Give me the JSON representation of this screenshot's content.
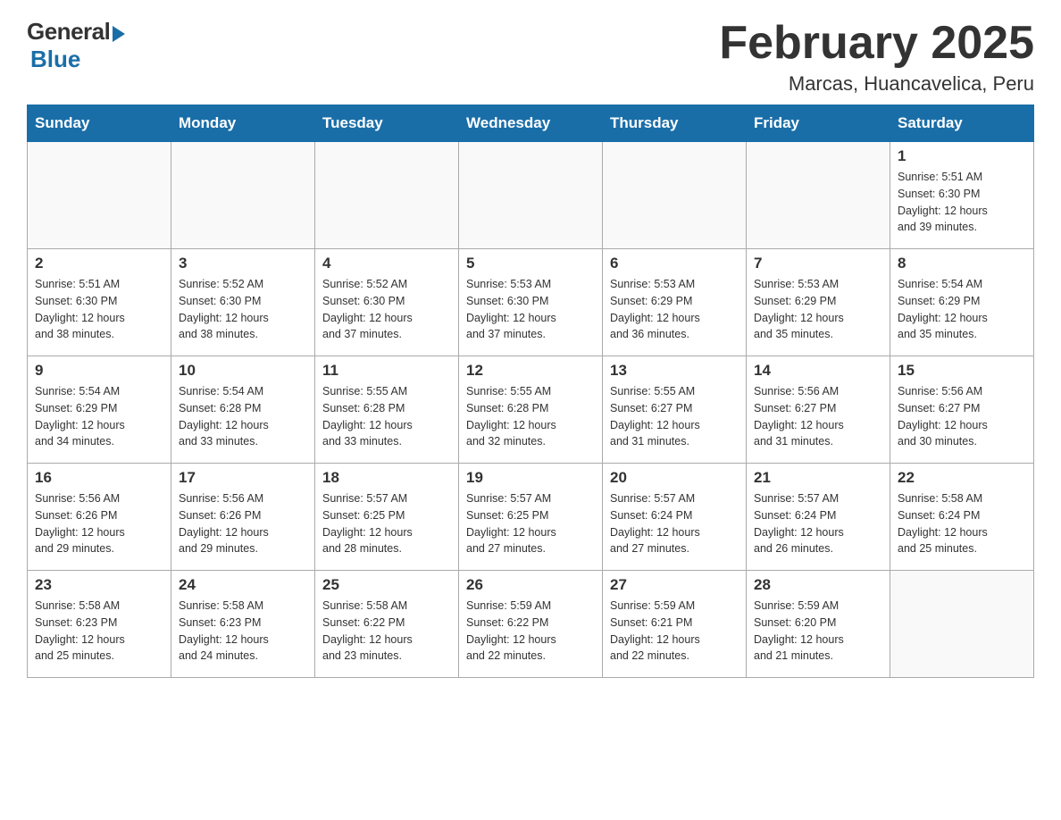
{
  "logo": {
    "general": "General",
    "blue": "Blue"
  },
  "header": {
    "month_year": "February 2025",
    "location": "Marcas, Huancavelica, Peru"
  },
  "weekdays": [
    "Sunday",
    "Monday",
    "Tuesday",
    "Wednesday",
    "Thursday",
    "Friday",
    "Saturday"
  ],
  "weeks": [
    [
      {
        "day": "",
        "info": ""
      },
      {
        "day": "",
        "info": ""
      },
      {
        "day": "",
        "info": ""
      },
      {
        "day": "",
        "info": ""
      },
      {
        "day": "",
        "info": ""
      },
      {
        "day": "",
        "info": ""
      },
      {
        "day": "1",
        "info": "Sunrise: 5:51 AM\nSunset: 6:30 PM\nDaylight: 12 hours\nand 39 minutes."
      }
    ],
    [
      {
        "day": "2",
        "info": "Sunrise: 5:51 AM\nSunset: 6:30 PM\nDaylight: 12 hours\nand 38 minutes."
      },
      {
        "day": "3",
        "info": "Sunrise: 5:52 AM\nSunset: 6:30 PM\nDaylight: 12 hours\nand 38 minutes."
      },
      {
        "day": "4",
        "info": "Sunrise: 5:52 AM\nSunset: 6:30 PM\nDaylight: 12 hours\nand 37 minutes."
      },
      {
        "day": "5",
        "info": "Sunrise: 5:53 AM\nSunset: 6:30 PM\nDaylight: 12 hours\nand 37 minutes."
      },
      {
        "day": "6",
        "info": "Sunrise: 5:53 AM\nSunset: 6:29 PM\nDaylight: 12 hours\nand 36 minutes."
      },
      {
        "day": "7",
        "info": "Sunrise: 5:53 AM\nSunset: 6:29 PM\nDaylight: 12 hours\nand 35 minutes."
      },
      {
        "day": "8",
        "info": "Sunrise: 5:54 AM\nSunset: 6:29 PM\nDaylight: 12 hours\nand 35 minutes."
      }
    ],
    [
      {
        "day": "9",
        "info": "Sunrise: 5:54 AM\nSunset: 6:29 PM\nDaylight: 12 hours\nand 34 minutes."
      },
      {
        "day": "10",
        "info": "Sunrise: 5:54 AM\nSunset: 6:28 PM\nDaylight: 12 hours\nand 33 minutes."
      },
      {
        "day": "11",
        "info": "Sunrise: 5:55 AM\nSunset: 6:28 PM\nDaylight: 12 hours\nand 33 minutes."
      },
      {
        "day": "12",
        "info": "Sunrise: 5:55 AM\nSunset: 6:28 PM\nDaylight: 12 hours\nand 32 minutes."
      },
      {
        "day": "13",
        "info": "Sunrise: 5:55 AM\nSunset: 6:27 PM\nDaylight: 12 hours\nand 31 minutes."
      },
      {
        "day": "14",
        "info": "Sunrise: 5:56 AM\nSunset: 6:27 PM\nDaylight: 12 hours\nand 31 minutes."
      },
      {
        "day": "15",
        "info": "Sunrise: 5:56 AM\nSunset: 6:27 PM\nDaylight: 12 hours\nand 30 minutes."
      }
    ],
    [
      {
        "day": "16",
        "info": "Sunrise: 5:56 AM\nSunset: 6:26 PM\nDaylight: 12 hours\nand 29 minutes."
      },
      {
        "day": "17",
        "info": "Sunrise: 5:56 AM\nSunset: 6:26 PM\nDaylight: 12 hours\nand 29 minutes."
      },
      {
        "day": "18",
        "info": "Sunrise: 5:57 AM\nSunset: 6:25 PM\nDaylight: 12 hours\nand 28 minutes."
      },
      {
        "day": "19",
        "info": "Sunrise: 5:57 AM\nSunset: 6:25 PM\nDaylight: 12 hours\nand 27 minutes."
      },
      {
        "day": "20",
        "info": "Sunrise: 5:57 AM\nSunset: 6:24 PM\nDaylight: 12 hours\nand 27 minutes."
      },
      {
        "day": "21",
        "info": "Sunrise: 5:57 AM\nSunset: 6:24 PM\nDaylight: 12 hours\nand 26 minutes."
      },
      {
        "day": "22",
        "info": "Sunrise: 5:58 AM\nSunset: 6:24 PM\nDaylight: 12 hours\nand 25 minutes."
      }
    ],
    [
      {
        "day": "23",
        "info": "Sunrise: 5:58 AM\nSunset: 6:23 PM\nDaylight: 12 hours\nand 25 minutes."
      },
      {
        "day": "24",
        "info": "Sunrise: 5:58 AM\nSunset: 6:23 PM\nDaylight: 12 hours\nand 24 minutes."
      },
      {
        "day": "25",
        "info": "Sunrise: 5:58 AM\nSunset: 6:22 PM\nDaylight: 12 hours\nand 23 minutes."
      },
      {
        "day": "26",
        "info": "Sunrise: 5:59 AM\nSunset: 6:22 PM\nDaylight: 12 hours\nand 22 minutes."
      },
      {
        "day": "27",
        "info": "Sunrise: 5:59 AM\nSunset: 6:21 PM\nDaylight: 12 hours\nand 22 minutes."
      },
      {
        "day": "28",
        "info": "Sunrise: 5:59 AM\nSunset: 6:20 PM\nDaylight: 12 hours\nand 21 minutes."
      },
      {
        "day": "",
        "info": ""
      }
    ]
  ]
}
